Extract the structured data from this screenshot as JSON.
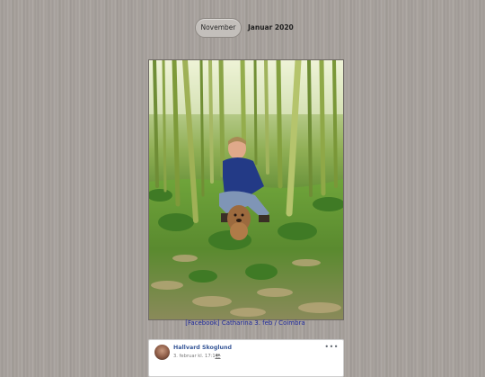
{
  "nav": {
    "prev_label": "November",
    "current_label": "Januar 2020"
  },
  "photo": {
    "caption": "[Facebook] Catharina 3. feb / Coimbra"
  },
  "facebook_post": {
    "author": "Hallvard Skoglund",
    "date": "3. februar kl. 17:14 ·",
    "audience_icon": "people-icon",
    "more_icon": "more-options-icon"
  },
  "colors": {
    "background": "#a8a29d",
    "caption_link": "#1f2a9c",
    "facebook_name": "#385898"
  }
}
